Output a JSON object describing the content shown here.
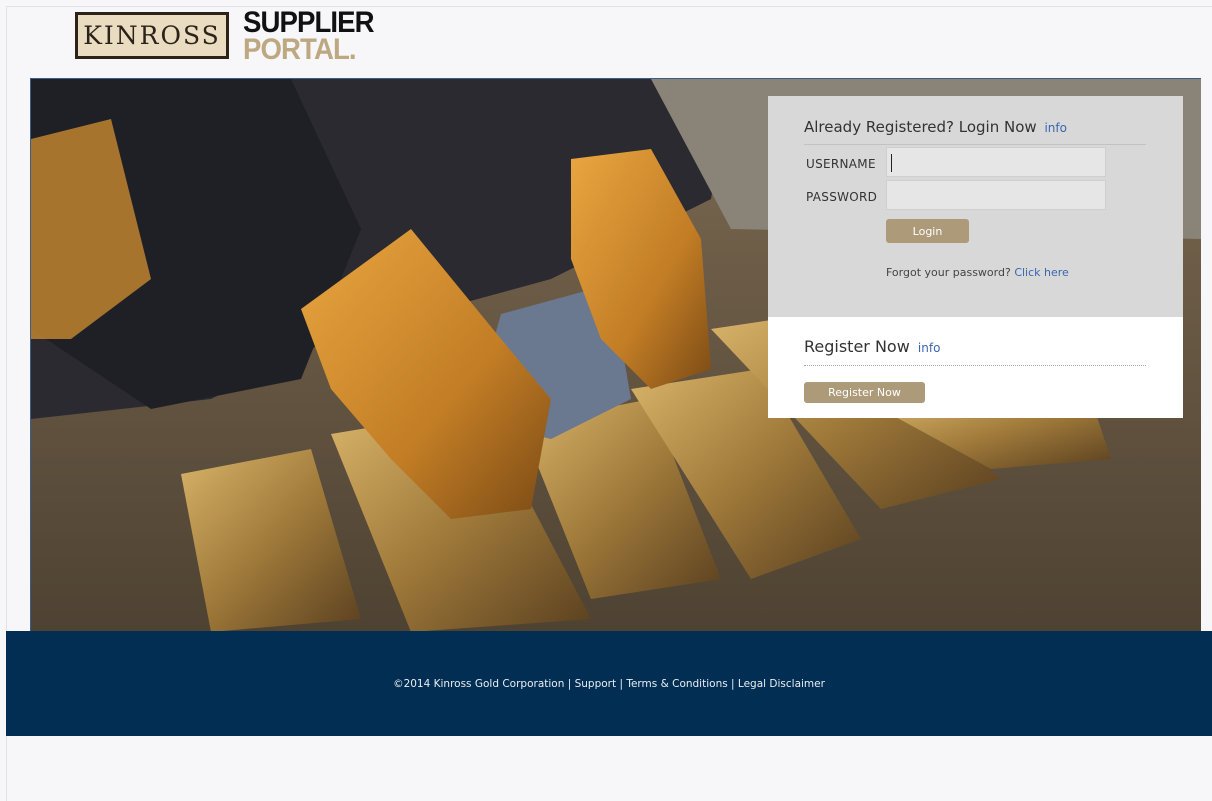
{
  "brand": {
    "logo_text": "KINROSS",
    "portal_line1": "SUPPLIER",
    "portal_line2": "PORTAL."
  },
  "login": {
    "title": "Already Registered? Login Now",
    "info_link": "info",
    "username_label": "USERNAME",
    "username_value": "",
    "password_label": "PASSWORD",
    "password_value": "",
    "login_button": "Login",
    "forgot_text": "Forgot your password?",
    "forgot_link": "Click here"
  },
  "register": {
    "title": "Register Now",
    "info_link": "info",
    "button": "Register Now"
  },
  "footer": {
    "copyright": "©2014 Kinross Gold Corporation",
    "sep": " | ",
    "support": "Support",
    "terms": "Terms & Conditions",
    "legal": "Legal Disclaimer"
  },
  "colors": {
    "accent_gold": "#ad9a78",
    "footer_navy": "#012e52",
    "link_blue": "#3a66b0"
  }
}
